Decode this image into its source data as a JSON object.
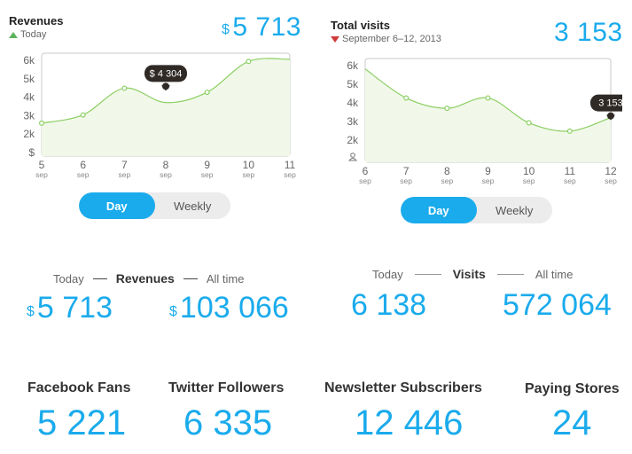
{
  "revenues_card": {
    "title": "Revenues",
    "subtitle": "Today",
    "currency": "$",
    "value": "5 713",
    "tooltip": "$ 4 304",
    "yticks": [
      "6k",
      "5k",
      "4k",
      "3k",
      "2k",
      "$"
    ],
    "xticks": [
      {
        "day": "5",
        "mon": "sep"
      },
      {
        "day": "6",
        "mon": "sep"
      },
      {
        "day": "7",
        "mon": "sep"
      },
      {
        "day": "8",
        "mon": "sep"
      },
      {
        "day": "9",
        "mon": "sep"
      },
      {
        "day": "10",
        "mon": "sep"
      },
      {
        "day": "11",
        "mon": "sep"
      }
    ],
    "toggle": {
      "day": "Day",
      "weekly": "Weekly"
    }
  },
  "visits_card": {
    "title": "Total visits",
    "subtitle": "September 6–12, 2013",
    "value": "3 153",
    "tooltip": "3 153",
    "yticks": [
      "6k",
      "5k",
      "4k",
      "3k",
      "2k"
    ],
    "xticks": [
      {
        "day": "6",
        "mon": "sep"
      },
      {
        "day": "7",
        "mon": "sep"
      },
      {
        "day": "8",
        "mon": "sep"
      },
      {
        "day": "9",
        "mon": "sep"
      },
      {
        "day": "10",
        "mon": "sep"
      },
      {
        "day": "11",
        "mon": "sep"
      },
      {
        "day": "12",
        "mon": "sep"
      }
    ],
    "toggle": {
      "day": "Day",
      "weekly": "Weekly"
    }
  },
  "revenues_summary": {
    "today_label": "Today",
    "title": "Revenues",
    "alltime_label": "All time",
    "currency": "$",
    "today_value": "5 713",
    "alltime_value": "103 066"
  },
  "visits_summary": {
    "today_label": "Today",
    "title": "Visits",
    "alltime_label": "All time",
    "today_value": "6 138",
    "alltime_value": "572 064"
  },
  "stats": [
    {
      "label": "Facebook Fans",
      "value": "5 221"
    },
    {
      "label": "Twitter Followers",
      "value": "6 335"
    },
    {
      "label": "Newsletter Subscribers",
      "value": "12 446"
    },
    {
      "label": "Paying Stores",
      "value": "24"
    }
  ],
  "chart_data": [
    {
      "type": "area",
      "title": "Revenues",
      "x": [
        "5 sep",
        "6 sep",
        "7 sep",
        "8 sep",
        "9 sep",
        "10 sep",
        "11 sep"
      ],
      "values": [
        2600,
        3000,
        4300,
        3600,
        4100,
        5600,
        5700
      ],
      "point_values": [
        2600,
        3000,
        4300,
        3600,
        4100,
        5600
      ],
      "ylim": [
        1000,
        6000
      ],
      "highlight": {
        "x": "8 sep",
        "value": 4304
      },
      "grid": false
    },
    {
      "type": "area",
      "title": "Total visits",
      "x": [
        "6 sep",
        "7 sep",
        "8 sep",
        "9 sep",
        "10 sep",
        "11 sep",
        "12 sep"
      ],
      "values": [
        5500,
        4100,
        3600,
        4100,
        2900,
        2500,
        3153
      ],
      "ylim": [
        1000,
        6000
      ],
      "highlight": {
        "x": "12 sep",
        "value": 3153
      },
      "grid": false
    }
  ],
  "colors": {
    "accent": "#1aabec",
    "line": "#8ccf63",
    "fill": "#f1f8e9",
    "up": "#5db35d",
    "down": "#d23a3a",
    "tooltip": "#2f2a26"
  }
}
